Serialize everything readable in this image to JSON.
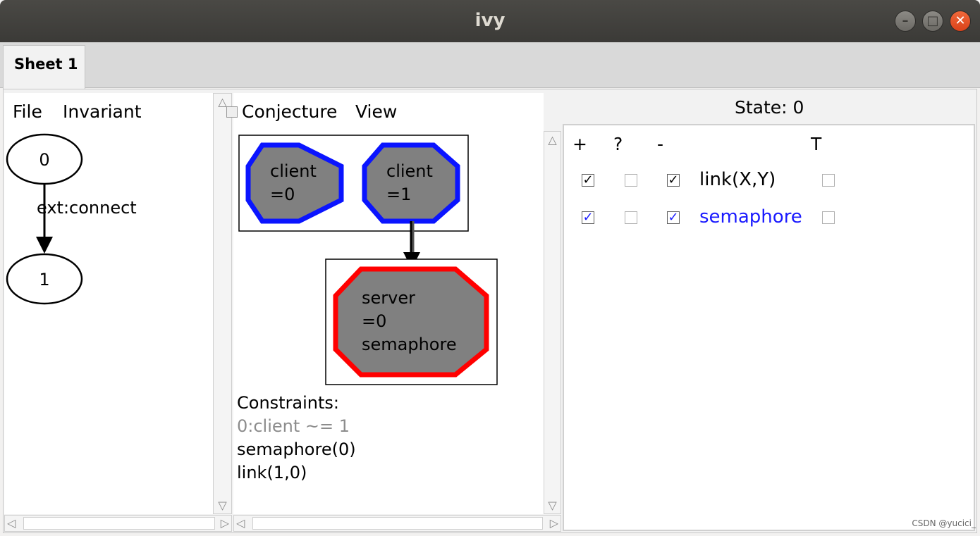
{
  "window": {
    "title": "ivy",
    "minimize_glyph": "–",
    "maximize_glyph": "□",
    "close_glyph": "✕"
  },
  "tabs": [
    {
      "label": "Sheet 1",
      "active": true
    }
  ],
  "left_panel": {
    "menu": [
      "File",
      "Invariant"
    ],
    "graph": {
      "nodes": [
        "0",
        "1"
      ],
      "edge_label": "ext:connect"
    }
  },
  "middle_panel": {
    "menu": [
      "Conjecture",
      "View"
    ],
    "nodes": {
      "client0": [
        "client",
        "=0"
      ],
      "client1": [
        "client",
        "=1"
      ],
      "server": [
        "server",
        "=0",
        "semaphore"
      ]
    },
    "constraints": {
      "heading": "Constraints:",
      "items": [
        {
          "text": "0:client ~= 1",
          "color": "#8c8c8c"
        },
        {
          "text": "semaphore(0)",
          "color": "#000000"
        },
        {
          "text": "link(1,0)",
          "color": "#000000"
        }
      ]
    }
  },
  "right_panel": {
    "state_label": "State: 0",
    "headers": {
      "plus": "+",
      "question": "?",
      "minus": "-",
      "t": "T"
    },
    "rows": [
      {
        "plus": true,
        "question": false,
        "minus": true,
        "label": "link(X,Y)",
        "t": false,
        "color": "#000000"
      },
      {
        "plus": true,
        "question": false,
        "minus": true,
        "label": "semaphore",
        "t": false,
        "color": "#1a1aff"
      }
    ]
  },
  "colors": {
    "client_border": "#0a14ff",
    "server_border": "#ff0000",
    "node_fill": "#808080"
  },
  "watermark": "CSDN @yucici_"
}
